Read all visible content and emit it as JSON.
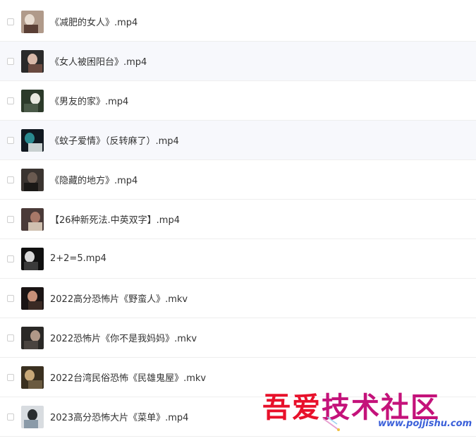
{
  "files": [
    {
      "name": "《减肥的女人》.mp4",
      "thumb": [
        "#b09a8a",
        "#e8dcd0",
        "#5a3f35"
      ]
    },
    {
      "name": "《女人被困阳台》.mp4",
      "thumb": [
        "#2a2a2a",
        "#d8b8a8",
        "#6a4a40"
      ]
    },
    {
      "name": "《男友的家》.mp4",
      "thumb": [
        "#2c3a2a",
        "#e8e8e0",
        "#4a5a48"
      ]
    },
    {
      "name": "《蚊子爱情》（反转麻了）.mp4",
      "thumb": [
        "#101820",
        "#2a8a90",
        "#c8d0d0"
      ]
    },
    {
      "name": "《隐藏的地方》.mp4",
      "thumb": [
        "#3a3430",
        "#6a5a50",
        "#1a1816"
      ]
    },
    {
      "name": "【26种新死法.中英双字】.mp4",
      "thumb": [
        "#4a3a38",
        "#a87868",
        "#d0c0b0"
      ]
    },
    {
      "name": "2+2=5.mp4",
      "thumb": [
        "#101010",
        "#d8d8d8",
        "#3a3a3a"
      ]
    },
    {
      "name": "2022高分恐怖片《野蛮人》.mkv",
      "thumb": [
        "#1a1414",
        "#c89078",
        "#3a2a24"
      ]
    },
    {
      "name": "2022恐怖片《你不是我妈妈》.mkv",
      "thumb": [
        "#2a2826",
        "#b09888",
        "#4a4440"
      ]
    },
    {
      "name": "2022台湾民俗恐怖《民雄鬼屋》.mkv",
      "thumb": [
        "#3a3020",
        "#c8a878",
        "#6a5a40"
      ]
    },
    {
      "name": "2023高分恐怖大片《菜单》.mp4",
      "thumb": [
        "#d8dce0",
        "#2a2e30",
        "#8a9aa8"
      ]
    }
  ],
  "watermark": {
    "title_a": "吾爱",
    "title_b": "技术社区",
    "url": "www.pojjishu.com"
  }
}
